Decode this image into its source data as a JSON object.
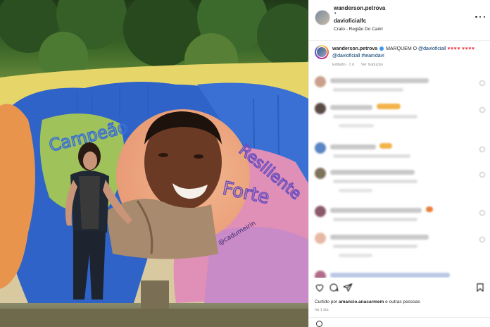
{
  "post": {
    "username": "wanderson.petrova",
    "separator": "•",
    "collab_username": "davioficialfc",
    "location": "Crato - Região Do Cariri"
  },
  "caption": {
    "username": "wanderson.petrova",
    "text_start": "MARQUEM O",
    "mention_1": "@davioficiall",
    "hearts_1": "♥♥♥♥",
    "hearts_2": "♥♥♥♥",
    "mention_2": "@davioficiall",
    "hashtag": "#teamdavi",
    "meta_edited": "Editado · 1 d",
    "meta_translate": "Ver tradução"
  },
  "likes": {
    "prefix": "Curtido por",
    "user": "amancio.anacarmem",
    "suffix": "e outras pessoas"
  },
  "date": "há 1 dia",
  "photo": {
    "mural_text_left": "Campeão",
    "mural_text_right": "Resiliente Forte",
    "artist_signature": "@cadumeirin"
  },
  "colors": {
    "accent_blue": "#3897f0",
    "heart_red": "#ed4956",
    "mention_blue": "#00376b",
    "meta_grey": "#8e8e8e"
  },
  "icons": [
    "more-options-icon",
    "verified-icon",
    "heart-icon",
    "comment-icon",
    "share-icon",
    "bookmark-icon",
    "emoji-icon"
  ]
}
